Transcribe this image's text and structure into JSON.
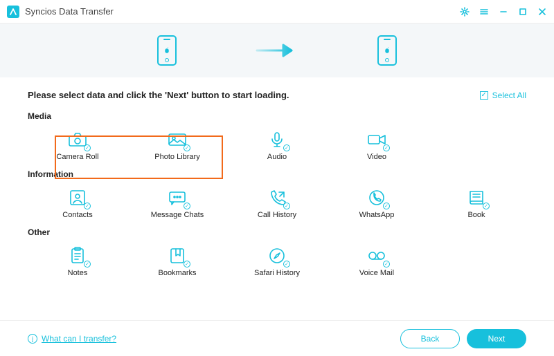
{
  "app": {
    "title": "Syncios Data Transfer"
  },
  "instruction": "Please select data and click the 'Next' button to start loading.",
  "select_all_label": "Select All",
  "sections": {
    "media": {
      "label": "Media",
      "items": [
        {
          "id": "camera-roll",
          "label": "Camera Roll"
        },
        {
          "id": "photo-library",
          "label": "Photo Library"
        },
        {
          "id": "audio",
          "label": "Audio"
        },
        {
          "id": "video",
          "label": "Video"
        }
      ]
    },
    "information": {
      "label": "Information",
      "items": [
        {
          "id": "contacts",
          "label": "Contacts"
        },
        {
          "id": "message-chats",
          "label": "Message Chats"
        },
        {
          "id": "call-history",
          "label": "Call History"
        },
        {
          "id": "whatsapp",
          "label": "WhatsApp"
        },
        {
          "id": "book",
          "label": "Book"
        }
      ]
    },
    "other": {
      "label": "Other",
      "items": [
        {
          "id": "notes",
          "label": "Notes"
        },
        {
          "id": "bookmarks",
          "label": "Bookmarks"
        },
        {
          "id": "safari-history",
          "label": "Safari History"
        },
        {
          "id": "voice-mail",
          "label": "Voice Mail"
        }
      ]
    }
  },
  "help_link": "What can I transfer?",
  "buttons": {
    "back": "Back",
    "next": "Next"
  }
}
